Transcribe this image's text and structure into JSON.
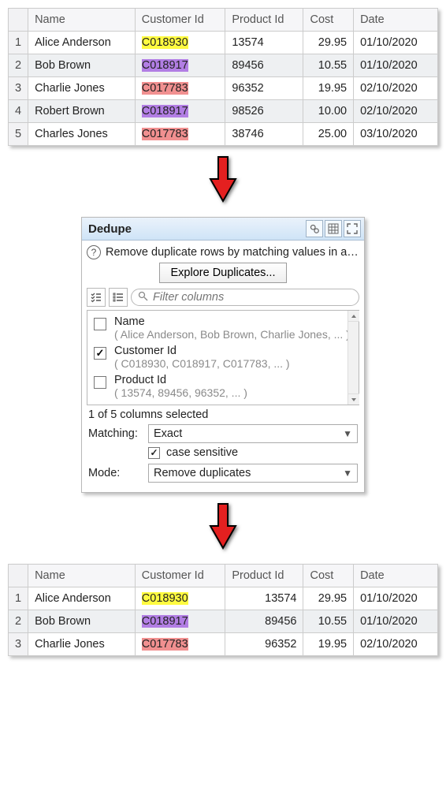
{
  "tableTop": {
    "headers": [
      "Name",
      "Customer Id",
      "Product Id",
      "Cost",
      "Date"
    ],
    "rows": [
      {
        "n": "1",
        "name": "Alice Anderson",
        "cid": "C018930",
        "hl": "hl-yellow",
        "pid": "13574",
        "cost": "29.95",
        "date": "01/10/2020"
      },
      {
        "n": "2",
        "name": "Bob Brown",
        "cid": "C018917",
        "hl": "hl-purple",
        "pid": "89456",
        "cost": "10.55",
        "date": "01/10/2020"
      },
      {
        "n": "3",
        "name": "Charlie Jones",
        "cid": "C017783",
        "hl": "hl-red",
        "pid": "96352",
        "cost": "19.95",
        "date": "02/10/2020"
      },
      {
        "n": "4",
        "name": "Robert Brown",
        "cid": "C018917",
        "hl": "hl-purple",
        "pid": "98526",
        "cost": "10.00",
        "date": "02/10/2020"
      },
      {
        "n": "5",
        "name": "Charles Jones",
        "cid": "C017783",
        "hl": "hl-red",
        "pid": "38746",
        "cost": "25.00",
        "date": "03/10/2020"
      }
    ]
  },
  "panel": {
    "title": "Dedupe",
    "desc": "Remove duplicate rows by matching values in al…",
    "exploreLabel": "Explore Duplicates...",
    "filterPlaceholder": "Filter columns",
    "columns": [
      {
        "label": "Name",
        "hint": "( Alice Anderson, Bob Brown, Charlie Jones, ... )",
        "checked": false
      },
      {
        "label": "Customer Id",
        "hint": "( C018930, C018917, C017783, ... )",
        "checked": true
      },
      {
        "label": "Product Id",
        "hint": "( 13574, 89456, 96352, ... )",
        "checked": false
      }
    ],
    "selectedText": "1 of 5 columns selected",
    "matchingLabel": "Matching:",
    "matchingValue": "Exact",
    "caseCheck": "✓",
    "caseLabel": "case sensitive",
    "modeLabel": "Mode:",
    "modeValue": "Remove duplicates"
  },
  "tableBot": {
    "headers": [
      "Name",
      "Customer Id",
      "Product Id",
      "Cost",
      "Date"
    ],
    "rows": [
      {
        "n": "1",
        "name": "Alice Anderson",
        "cid": "C018930",
        "hl": "hl-yellow",
        "pid": "13574",
        "cost": "29.95",
        "date": "01/10/2020"
      },
      {
        "n": "2",
        "name": "Bob Brown",
        "cid": "C018917",
        "hl": "hl-purple",
        "pid": "89456",
        "cost": "10.55",
        "date": "01/10/2020"
      },
      {
        "n": "3",
        "name": "Charlie Jones",
        "cid": "C017783",
        "hl": "hl-red",
        "pid": "96352",
        "cost": "19.95",
        "date": "02/10/2020"
      }
    ]
  }
}
